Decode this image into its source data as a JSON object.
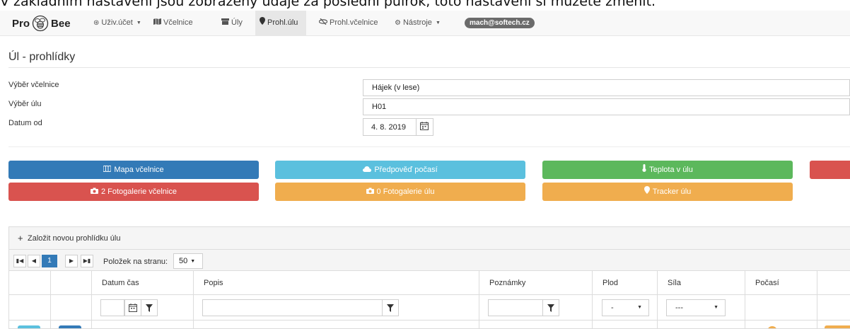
{
  "banner": "V základním nastavení jsou zobrazeny údaje za poslední půlrok, toto nastavení si můžete změnit.",
  "brand": {
    "pre": "Pro",
    "post": "Bee"
  },
  "nav": [
    {
      "label": "Uživ.účet",
      "dropdown": true,
      "icon": "user-circle-icon"
    },
    {
      "label": "Včelnice",
      "icon": "map-icon"
    },
    {
      "label": "Úly",
      "icon": "archive-icon"
    },
    {
      "label": "Prohl.úlu",
      "icon": "map-marker-icon",
      "active": true
    },
    {
      "label": "Prohl.včelnice",
      "icon": "eye-slash-icon"
    },
    {
      "label": "Nástroje",
      "dropdown": true,
      "icon": "cogs-icon"
    }
  ],
  "email": "mach@softech.cz",
  "page_title": "Úl - prohlídky",
  "filters": {
    "apiary_label": "Výběr včelnice",
    "apiary_value": "Hájek (v lese)",
    "hive_label": "Výběr úlu",
    "hive_value": "H01",
    "date_label": "Datum od",
    "date_value": "4. 8. 2019"
  },
  "buttons": {
    "map": "Mapa včelnice",
    "forecast": "Předpověď počasí",
    "temperature": "Teplota v úlu",
    "apiary_gallery": "2  Fotogalerie včelnice",
    "hive_gallery": "0  Fotogalerie úlu",
    "tracker": "Tracker úlu"
  },
  "grid": {
    "new_label": "Založit novou prohlídku úlu",
    "current_page": "1",
    "page_size_label": "Položek na stranu:",
    "page_size": "50",
    "columns": [
      "Datum čas",
      "Popis",
      "Poznámky",
      "Plod",
      "Síla",
      "Počasí"
    ],
    "plod_filter": "-",
    "sila_filter": "---"
  },
  "colors": {
    "primary": "#337ab7",
    "info": "#5bc0de",
    "success": "#5cb85c",
    "danger": "#d9534f",
    "warning": "#f0ad4e"
  }
}
